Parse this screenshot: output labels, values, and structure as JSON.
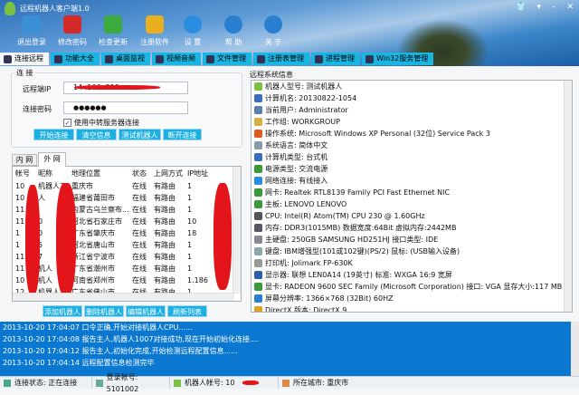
{
  "app": {
    "title": "远程机器人客户端1.0",
    "window_buttons": [
      "skin",
      "menu",
      "minimize",
      "close"
    ]
  },
  "toolbar": [
    {
      "label": "退出登录",
      "icon": "users-icon",
      "color": "#3a8fd6"
    },
    {
      "label": "修改密码",
      "icon": "lock-icon",
      "color": "#d42a2a"
    },
    {
      "label": "检查更新",
      "icon": "globe-icon",
      "color": "#3caa3c"
    },
    {
      "label": "注册软件",
      "icon": "software-icon",
      "color": "#e8b020"
    },
    {
      "label": "设 置",
      "icon": "gear-icon",
      "color": "#2a8ee0"
    },
    {
      "label": "帮 助",
      "icon": "help-icon",
      "color": "#2a7fd0"
    },
    {
      "label": "关 于",
      "icon": "info-icon",
      "color": "#2a7fd0"
    }
  ],
  "tabs": [
    "连接远程",
    "功能大全",
    "桌面监视",
    "视频音频",
    "文件管理",
    "注册表管理",
    "进程管理",
    "Win32服务管理"
  ],
  "connect": {
    "group_label": "连 接",
    "ip_label": "远程端IP",
    "ip_value": "14   .166.  210",
    "pwd_label": "连接密码",
    "pwd_value": "●●●●●●",
    "checkbox_label": "使用中转服务器连接",
    "checkbox_checked": true,
    "buttons": [
      "开始连接",
      "清空信息",
      "测试机器人",
      "断开连接"
    ]
  },
  "net_tabs": [
    "内 网",
    "外 网"
  ],
  "table": {
    "headers": [
      "帐号",
      "昵称",
      "地理位置",
      "状态",
      "上网方式",
      "IP地址"
    ],
    "rows": [
      [
        "10",
        "机器人7",
        "重庆市",
        "在线",
        "有路由",
        "1"
      ],
      [
        "10",
        "人",
        "福建省莆田市",
        "在线",
        "有路由",
        "1"
      ],
      [
        "11",
        "",
        "内蒙古乌兰察布...",
        "在线",
        "有路由",
        "1"
      ],
      [
        "11",
        "0",
        "河北省石家庄市",
        "在线",
        "有路由",
        "10"
      ],
      [
        "1",
        "0",
        "广东省肇庆市",
        "在线",
        "有路由",
        "18"
      ],
      [
        "1",
        "5",
        "河北省唐山市",
        "在线",
        "有路由",
        "1"
      ],
      [
        "11",
        "7",
        "浙江省宁波市",
        "在线",
        "有路由",
        "1"
      ],
      [
        "11",
        "机人",
        "广东省潮州市",
        "在线",
        "有路由",
        "1"
      ],
      [
        "10",
        "机人",
        "河南省郑州市",
        "在线",
        "有路由",
        "1.186"
      ],
      [
        "12",
        "机器人",
        "广东省佛山市",
        "在线",
        "有路由",
        "1"
      ]
    ]
  },
  "list_buttons": [
    "添加机器人",
    "删除机器人",
    "编辑机器人",
    "刷新列表"
  ],
  "sysinfo": {
    "label": "远程系统信息",
    "items": [
      {
        "text": "机器人型号: 测试机器人",
        "color": "#7cc242"
      },
      {
        "text": "计算机名: 20130822-1054",
        "color": "#3a6fc0"
      },
      {
        "text": "当前用户: Administrator",
        "color": "#5a7fb0"
      },
      {
        "text": "工作组: WORKGROUP",
        "color": "#d8b040"
      },
      {
        "text": "操作系统: Microsoft Windows XP Personal (32位) Service Pack 3",
        "color": "#e05a20"
      },
      {
        "text": "系统语言: 简体中文",
        "color": "#8899aa"
      },
      {
        "text": "计算机类型: 台式机",
        "color": "#3a6fc0"
      },
      {
        "text": "电源类型: 交流电源",
        "color": "#3a9a3a"
      },
      {
        "text": "网络连接: 有线接入",
        "color": "#2a8ee0"
      },
      {
        "text": "网卡: Realtek RTL8139 Family PCI Fast Ethernet NIC",
        "color": "#3a9a3a"
      },
      {
        "text": "主板: LENOVO LENOVO",
        "color": "#3a9a3a"
      },
      {
        "text": "CPU:        Intel(R) Atom(TM) CPU  230   @ 1.60GHz",
        "color": "#555"
      },
      {
        "text": "内存: DDR3(1015MB)  数据宽度:64Bit  虚拟内存:2442MB",
        "color": "#556"
      },
      {
        "text": "主硬盘: 250GB  SAMSUNG HD251HJ  接口类型: IDE",
        "color": "#889"
      },
      {
        "text": "键盘: IBM增强型(101或102键)(PS/2)    鼠标: (USB输入设备)",
        "color": "#8aa"
      },
      {
        "text": "打印机: Jolimark FP-630K",
        "color": "#999"
      },
      {
        "text": "显示器: 联想  LEN0A14 (19英寸) 标准: WXGA  16:9 宽屏",
        "color": "#2a5fb0"
      },
      {
        "text": "显卡: RADEON 9600 SEC Family (Microsoft Corporation)  接口: VGA  显存大小:117 MB",
        "color": "#3a9a3a"
      },
      {
        "text": "屏幕分辨率: 1366×768 (32Bit) 60HZ",
        "color": "#2a7fd0"
      },
      {
        "text": "DirectX 版本: DirectX 9",
        "color": "#e0a020"
      }
    ]
  },
  "log": [
    "2013-10-20 17:04:07 口令正确,开始对接机器人CPU......",
    "2013-10-20 17:04:08 报告主人,机器人1007对接成功,现在开始初始化连接....",
    "2013-10-20 17:04:12 报告主人,初始化完成,开始检测远程配置信息......",
    "2013-10-20 17:04:14 远程配置信息检测完毕"
  ],
  "status": {
    "connection": "连接状态: 正在连接",
    "login": "登录帐号: 5101002",
    "robot": "机器人帐号: 10",
    "city": "所在城市: 重庆市"
  }
}
